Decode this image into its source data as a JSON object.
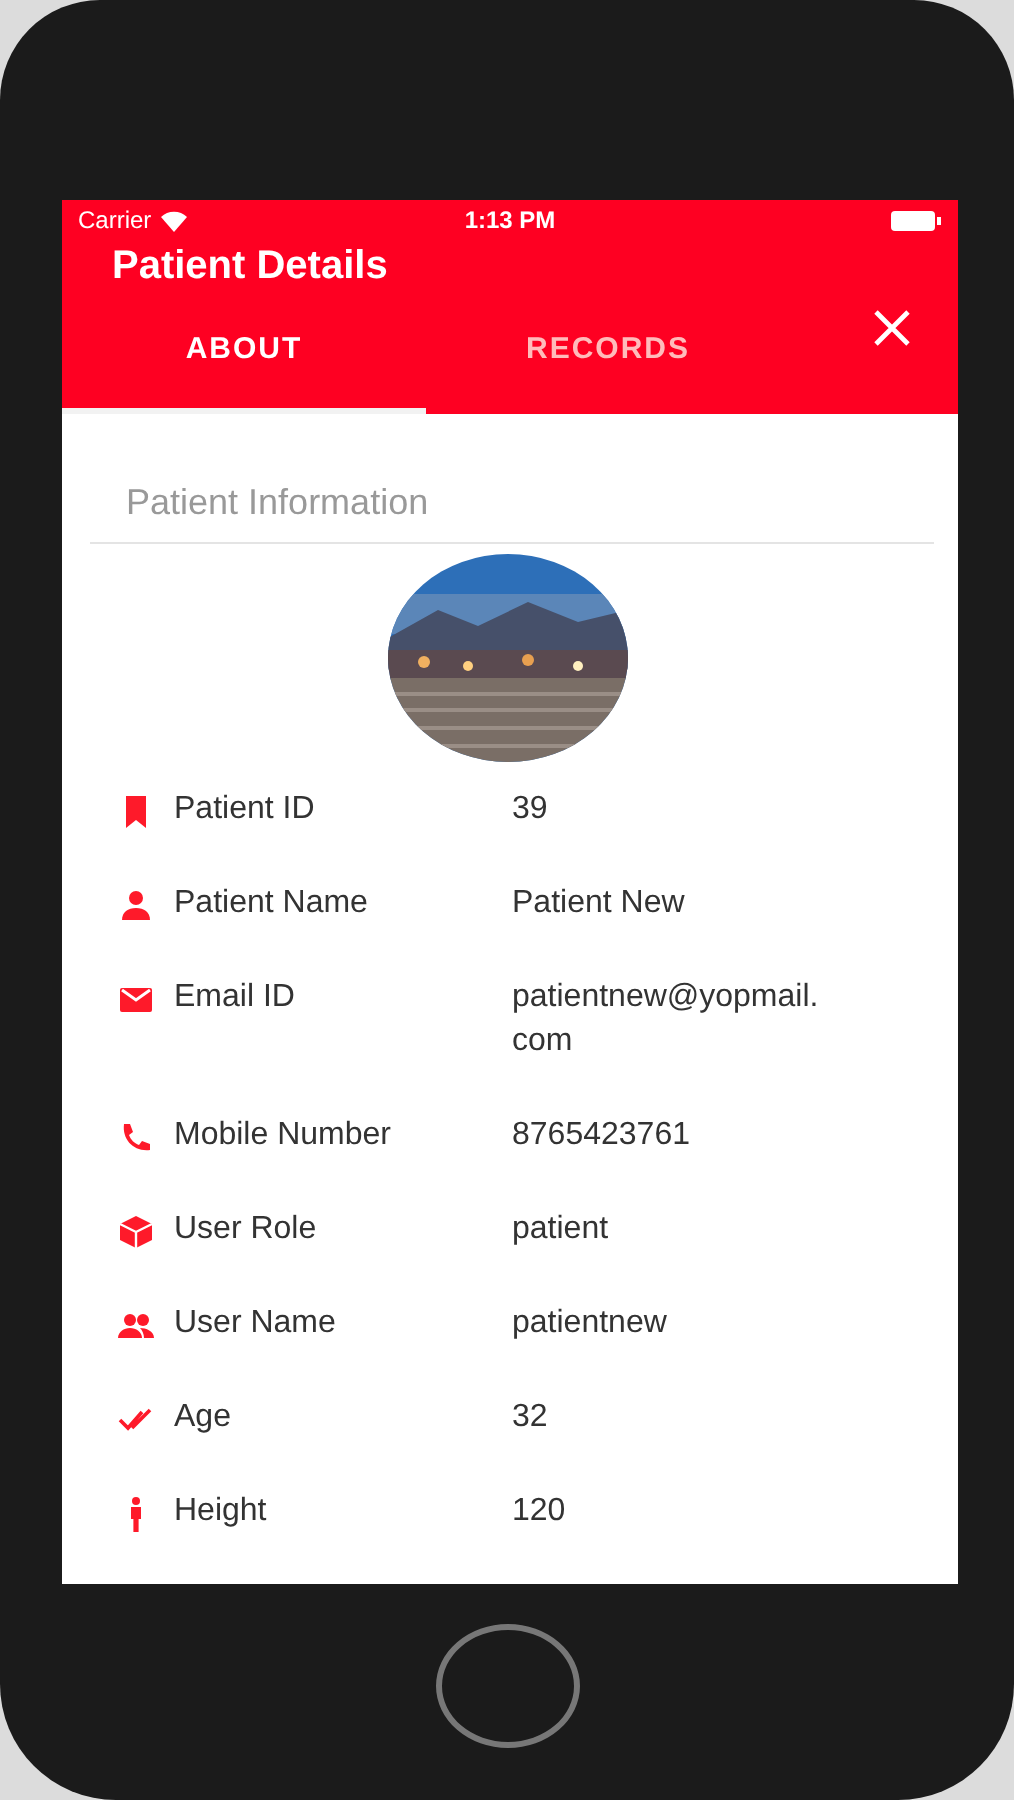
{
  "status_bar": {
    "carrier": "Carrier",
    "time": "1:13 PM"
  },
  "header": {
    "title": "Patient Details"
  },
  "tabs": [
    {
      "label": "ABOUT",
      "selected": true
    },
    {
      "label": "RECORDS",
      "selected": false
    }
  ],
  "section_title": "Patient Information",
  "fields": [
    {
      "kind": "bookmark",
      "label": "Patient ID",
      "value": "39"
    },
    {
      "kind": "person",
      "label": "Patient Name",
      "value": "Patient New"
    },
    {
      "kind": "mail",
      "label": "Email ID",
      "value": "patientnew@yopmail.\ncom"
    },
    {
      "kind": "phone",
      "label": "Mobile Number",
      "value": "8765423761"
    },
    {
      "kind": "cube",
      "label": "User Role",
      "value": "patient"
    },
    {
      "kind": "people",
      "label": "User Name",
      "value": "patientnew"
    },
    {
      "kind": "check",
      "label": "Age",
      "value": "32"
    },
    {
      "kind": "figure",
      "label": "Height",
      "value": "120"
    }
  ]
}
